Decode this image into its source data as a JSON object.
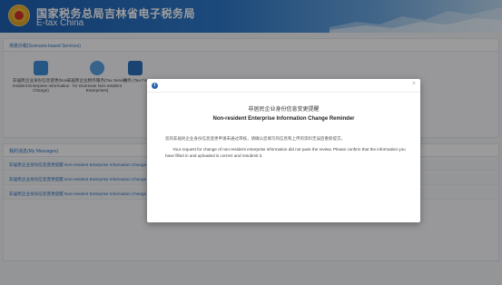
{
  "header": {
    "title_cn": "国家税务总局吉林省电子税务局",
    "title_en": "E-tax China"
  },
  "scenarios": {
    "heading": "场景办税(Scenario-based Services)",
    "services": [
      {
        "label": "非居民企业身份信息变更(Non-resident Enterprise Information Change)",
        "icon": "id-card-icon",
        "color": "#3d8bd6"
      },
      {
        "label": "非居民企业税务服务(Tax Service for Overseas Non-resident Enterprises)",
        "icon": "person-service-icon",
        "color": "#5aa0e0"
      },
      {
        "label": "税务 (Tax Fin",
        "icon": "document-stack-icon",
        "color": "#2c6fb8"
      }
    ]
  },
  "messages": {
    "heading": "我的消息(My Messages)",
    "items": [
      "非居民企业身份信息变更提醒 Non-resident Enterprise Information Change",
      "非居民企业身份信息变更提醒 Non-resident Enterprise Information Change",
      "非居民企业身份信息变更提醒 Non-resident Enterprise Information Change"
    ]
  },
  "modal": {
    "title_cn": "非居民企业身份信息变更提醒",
    "title_en": "Non-resident Enterprise Information Change Reminder",
    "body_cn": "您的非居民企业身份信息变更申请未通过审核，请确认您填写的信息和上传的资料无误后重新提交。",
    "body_en": "Your request for change of non-resident enterprise information did not pass the review. Please confirm that the information you have filled in and uploaded is correct and resubmit it.",
    "close_glyph": "×",
    "info_glyph": "i"
  }
}
